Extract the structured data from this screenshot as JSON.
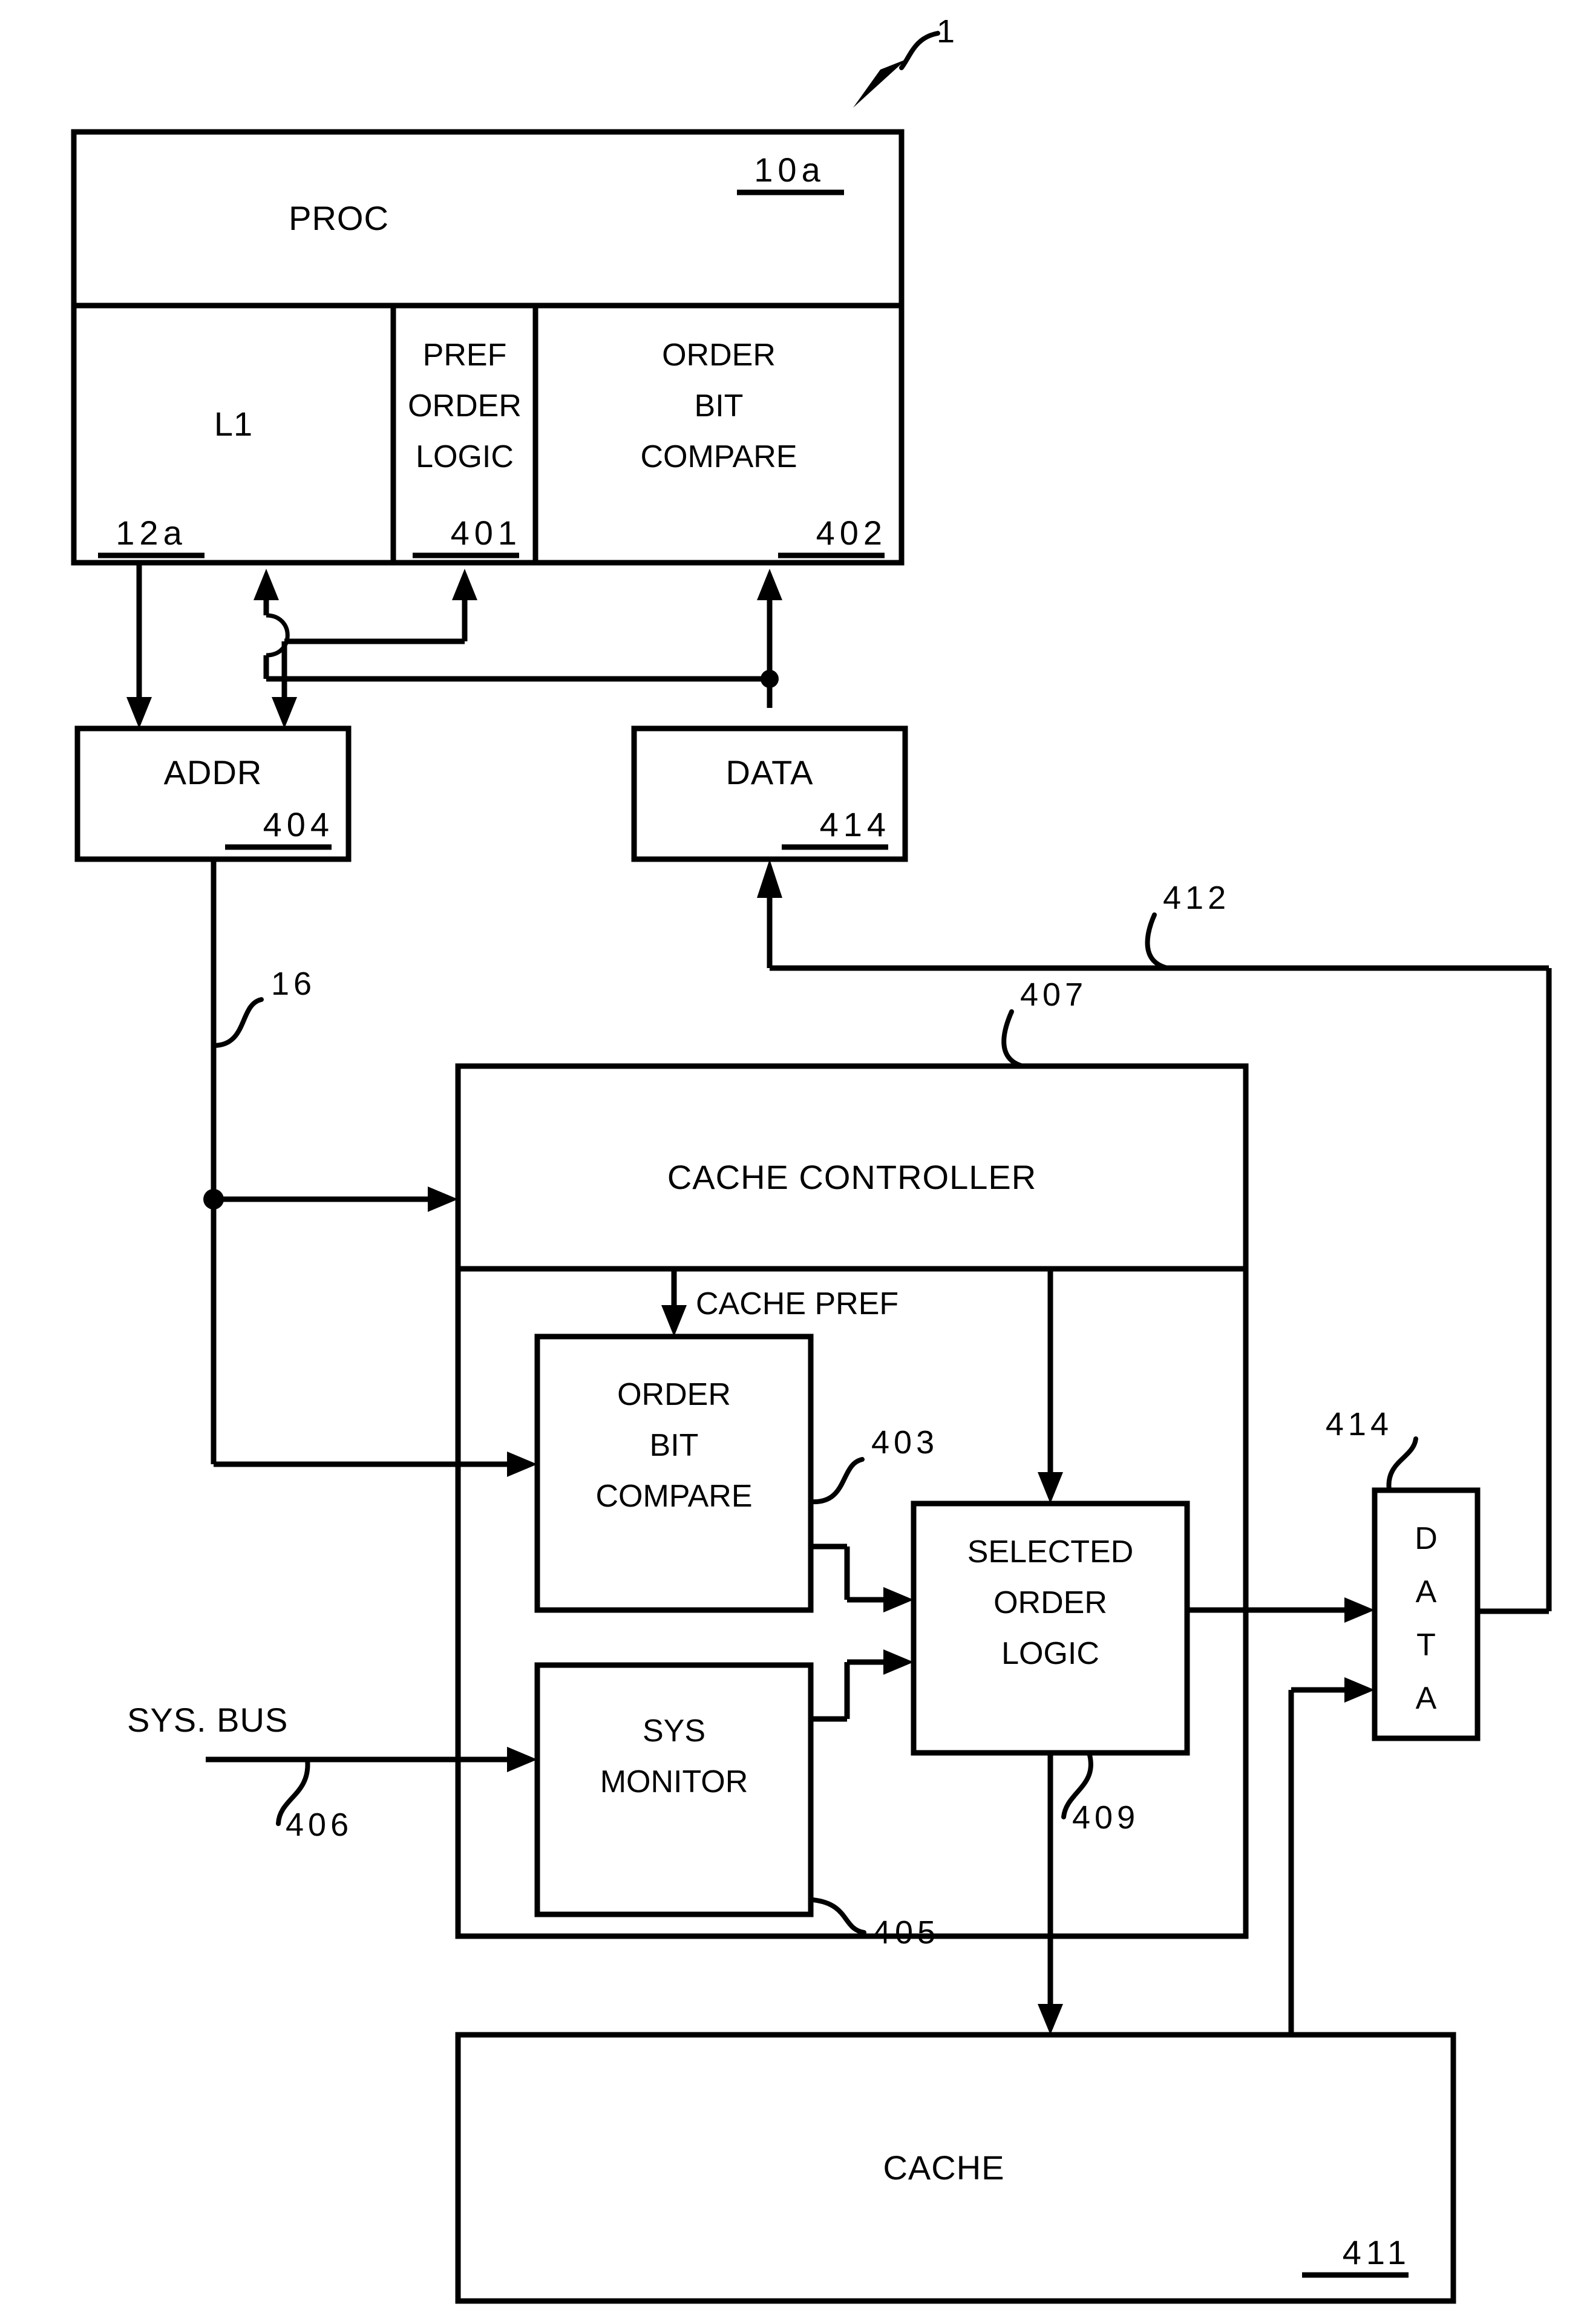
{
  "figure": {
    "label": "1",
    "type": "patent-block-diagram"
  },
  "blocks": {
    "proc": {
      "label": "PROC",
      "ref": "10a"
    },
    "l1": {
      "label": "L1",
      "ref": "12a"
    },
    "pref_order_logic": {
      "line1": "PREF",
      "line2": "ORDER",
      "line3": "LOGIC",
      "ref": "401"
    },
    "proc_order_bit_compare": {
      "line1": "ORDER",
      "line2": "BIT",
      "line3": "COMPARE",
      "ref": "402"
    },
    "addr": {
      "label": "ADDR",
      "ref": "404"
    },
    "data_top": {
      "label": "DATA",
      "ref": "414"
    },
    "cache_controller": {
      "label": "CACHE CONTROLLER",
      "ref": "407"
    },
    "cc_order_bit_compare": {
      "line1": "ORDER",
      "line2": "BIT",
      "line3": "COMPARE",
      "ref": "403"
    },
    "sys_monitor": {
      "line1": "SYS",
      "line2": "MONITOR",
      "ref": "405"
    },
    "selected_order_logic": {
      "line1": "SELECTED",
      "line2": "ORDER",
      "line3": "LOGIC",
      "ref": "409"
    },
    "data_right": {
      "letters": [
        "D",
        "A",
        "T",
        "A"
      ],
      "ref": "414"
    },
    "cache": {
      "label": "CACHE",
      "ref": "411"
    }
  },
  "signals": {
    "addr_bus": {
      "ref": "16"
    },
    "data_return_bus": {
      "ref": "412"
    },
    "sys_bus": {
      "label": "SYS. BUS",
      "ref": "406"
    },
    "cache_pref": {
      "label": "CACHE PREF"
    }
  },
  "colors": {
    "stroke": "#000000",
    "background": "#ffffff"
  }
}
